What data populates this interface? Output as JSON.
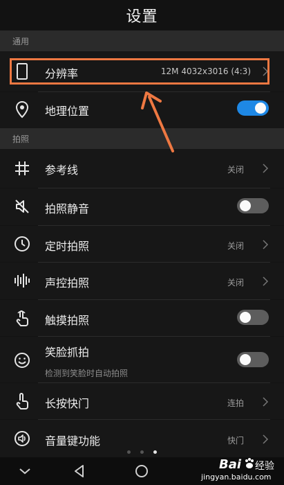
{
  "header": {
    "title": "设置"
  },
  "sections": {
    "general": "通用",
    "photo": "拍照"
  },
  "rows": {
    "resolution": {
      "label": "分辨率",
      "value": "12M 4032x3016 (4:3)",
      "icon": "phone-frame-icon"
    },
    "location": {
      "label": "地理位置",
      "toggle": true,
      "icon": "location-pin-icon"
    },
    "gridlines": {
      "label": "参考线",
      "value": "关闭",
      "icon": "grid-icon"
    },
    "mute": {
      "label": "拍照静音",
      "toggle": false,
      "icon": "speaker-mute-icon"
    },
    "timer": {
      "label": "定时拍照",
      "value": "关闭",
      "icon": "clock-icon"
    },
    "audio_control": {
      "label": "声控拍照",
      "value": "关闭",
      "icon": "soundwave-icon"
    },
    "touch_capture": {
      "label": "触摸拍照",
      "toggle": false,
      "icon": "touch-finger-icon"
    },
    "smile_capture": {
      "label": "笑脸抓拍",
      "sublabel": "检测到笑脸时自动拍照",
      "toggle": false,
      "icon": "smile-face-icon"
    },
    "long_press": {
      "label": "长按快门",
      "value": "连拍",
      "icon": "press-finger-icon"
    },
    "volume_key": {
      "label": "音量键功能",
      "value": "快门",
      "icon": "volume-key-icon"
    }
  },
  "page_indicator": {
    "count": 3,
    "active": 2
  },
  "watermark": {
    "brand": "Bai",
    "name": "经验",
    "url": "jingyan.baidu.com"
  },
  "colors": {
    "accent_toggle": "#1e88e5",
    "highlight": "#ee7842",
    "background": "#131313"
  }
}
